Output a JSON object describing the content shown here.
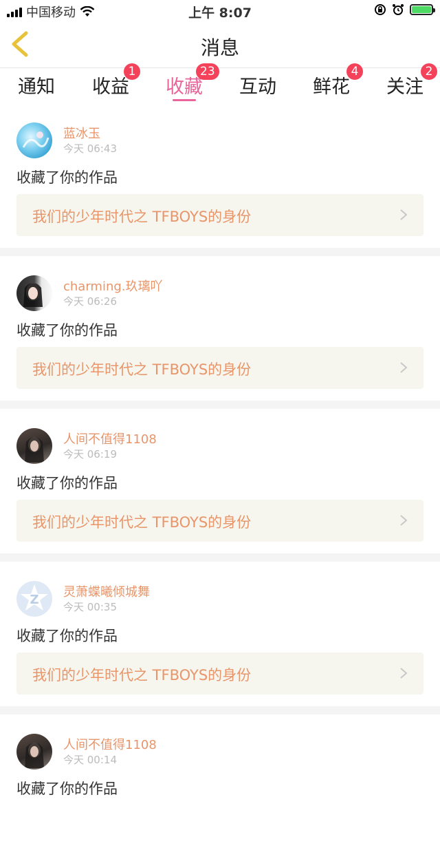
{
  "status_bar": {
    "carrier": "中国移动",
    "time": "上午 8:07"
  },
  "header": {
    "title": "消息"
  },
  "tabs": [
    {
      "label": "通知",
      "badge": ""
    },
    {
      "label": "收益",
      "badge": "1"
    },
    {
      "label": "收藏",
      "badge": "23",
      "active": true
    },
    {
      "label": "互动",
      "badge": ""
    },
    {
      "label": "鲜花",
      "badge": "4"
    },
    {
      "label": "关注",
      "badge": "2"
    }
  ],
  "feed": [
    {
      "name": "蓝冰玉",
      "time": "今天 06:43",
      "action": "收藏了你的作品",
      "work": "我们的少年时代之 TFBOYS的身份"
    },
    {
      "name": "charming.玖璃吖",
      "time": "今天 06:26",
      "action": "收藏了你的作品",
      "work": "我们的少年时代之 TFBOYS的身份"
    },
    {
      "name": "人间不值得1108",
      "time": "今天 06:19",
      "action": "收藏了你的作品",
      "work": "我们的少年时代之 TFBOYS的身份"
    },
    {
      "name": "灵萧蝶曦倾城舞",
      "time": "今天 00:35",
      "action": "收藏了你的作品",
      "work": "我们的少年时代之 TFBOYS的身份"
    },
    {
      "name": "人间不值得1108",
      "time": "今天 00:14",
      "action": "收藏了你的作品",
      "work": ""
    }
  ],
  "colors": {
    "accent": "#e8649a",
    "badge": "#f5425b",
    "name_text": "#e8956a",
    "back_icon": "#e6c33a"
  },
  "icons": {
    "back": "chevron-left-icon",
    "row": "chevron-right-icon"
  }
}
